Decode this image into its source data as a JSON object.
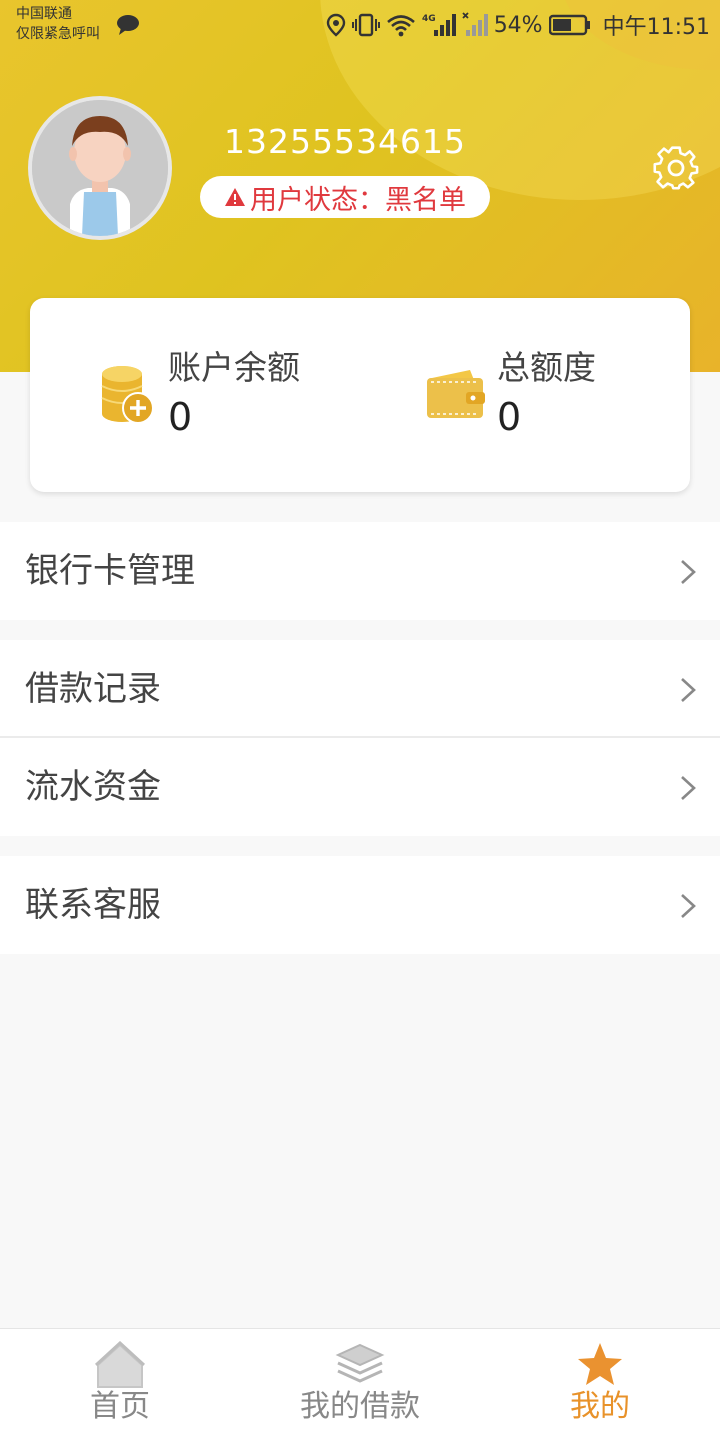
{
  "status_bar": {
    "carrier_line1": "中国联通",
    "carrier_line2": "仅限紧急呼叫",
    "battery": "54%",
    "time": "中午11:51",
    "network": "4G"
  },
  "profile": {
    "phone": "13255534615",
    "status_label": "用户状态：黑名单",
    "status_color": "#e0393e"
  },
  "summary": {
    "balance_label": "账户余额",
    "balance_value": "0",
    "limit_label": "总额度",
    "limit_value": "0"
  },
  "menu": {
    "bank_card": "银行卡管理",
    "loan_records": "借款记录",
    "cash_flow": "流水资金",
    "customer_service": "联系客服"
  },
  "tabbar": {
    "home": "首页",
    "my_loans": "我的借款",
    "mine": "我的",
    "active_color": "#e8922a"
  },
  "colors": {
    "header_gradient_start": "#e9c52d",
    "header_gradient_end": "#e8b32a",
    "page_background": "#f8f8f8"
  }
}
